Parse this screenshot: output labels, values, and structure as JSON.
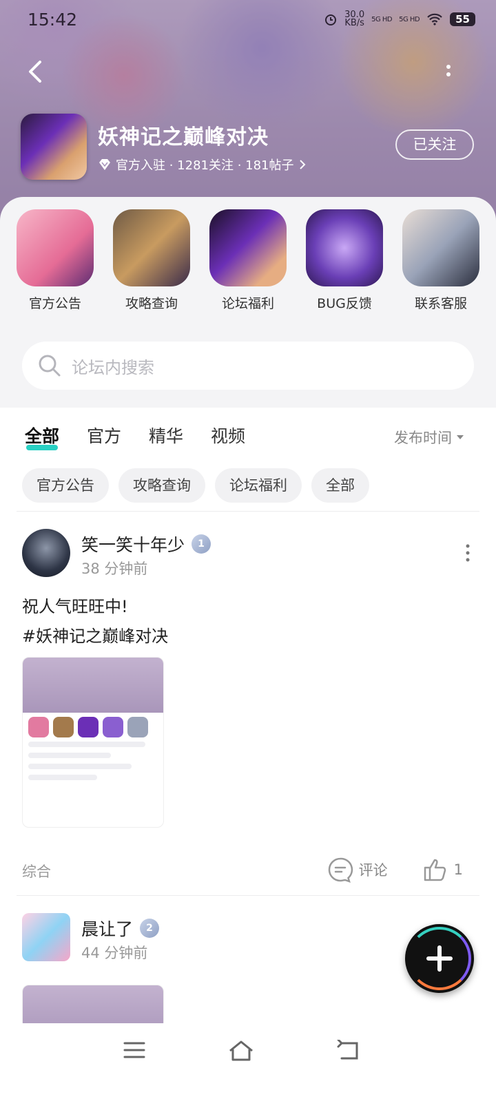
{
  "status_bar": {
    "time": "15:42",
    "net_speed": "30.0",
    "net_unit": "KB/s",
    "sig1": "5G HD",
    "sig2": "5G HD",
    "battery": "55"
  },
  "forum": {
    "title": "妖神记之巅峰对决",
    "meta": "官方入驻 · 1281关注 · 181帖子",
    "follow_label": "已关注"
  },
  "quick_links": [
    {
      "label": "官方公告"
    },
    {
      "label": "攻略查询"
    },
    {
      "label": "论坛福利"
    },
    {
      "label": "BUG反馈"
    },
    {
      "label": "联系客服"
    }
  ],
  "search": {
    "placeholder": "论坛内搜索"
  },
  "tabs": [
    {
      "label": "全部"
    },
    {
      "label": "官方"
    },
    {
      "label": "精华"
    },
    {
      "label": "视频"
    }
  ],
  "sort_label": "发布时间",
  "chips": [
    {
      "label": "官方公告"
    },
    {
      "label": "攻略查询"
    },
    {
      "label": "论坛福利"
    },
    {
      "label": "全部"
    }
  ],
  "posts": [
    {
      "user": "笑一笑十年少",
      "level": "1",
      "time": "38 分钟前",
      "text_line1": "祝人气旺旺中!",
      "text_line2": "#妖神记之巅峰对决",
      "category": "综合",
      "comment_label": "评论",
      "likes": "1"
    },
    {
      "user": "晨让了",
      "level": "2",
      "time": "44 分钟前"
    }
  ],
  "colors": {
    "accent": "#28d0c3"
  }
}
